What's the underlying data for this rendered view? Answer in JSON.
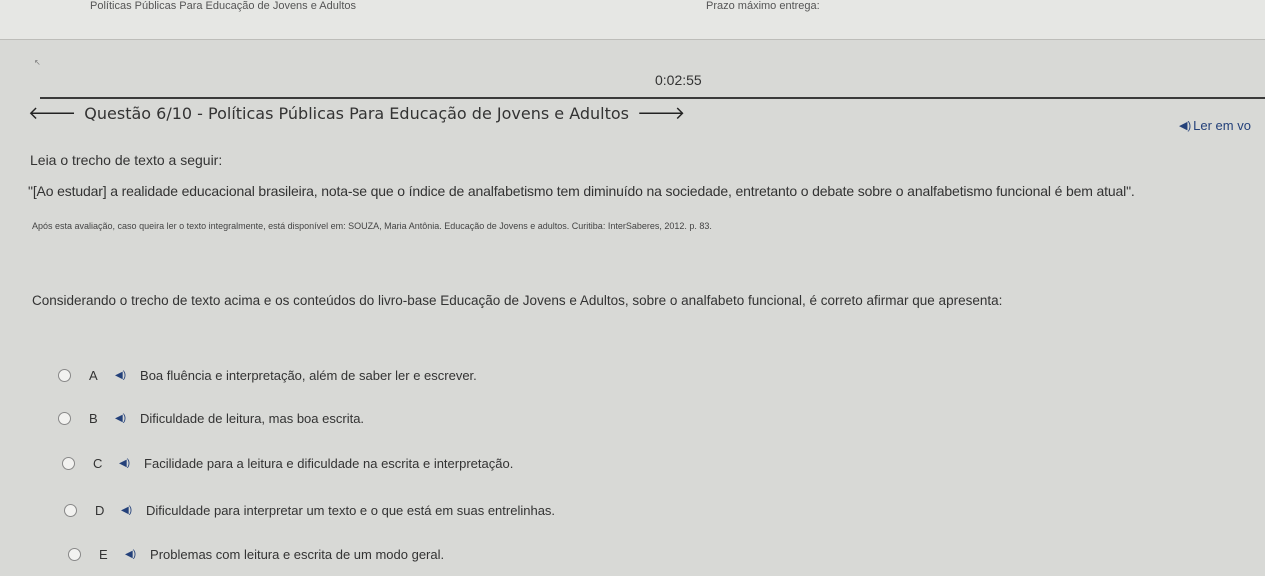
{
  "topbar": {
    "course_title": "Políticas Públicas Para Educação de Jovens e Adultos",
    "deadline_label": "Prazo máximo entrega:"
  },
  "timer": "0:02:55",
  "question": {
    "title": "Questão 6/10 - Políticas Públicas Para Educação de Jovens e Adultos",
    "listen_label": "Ler em vo",
    "intro": "Leia o trecho de texto a seguir:",
    "quote": "\"[Ao estudar] a realidade educacional brasileira, nota-se que o índice de analfabetismo tem diminuído na sociedade, entretanto o debate sobre o analfabetismo funcional é bem atual\".",
    "source": "Após esta avaliação, caso queira ler o texto integralmente, está disponível em: SOUZA, Maria Antônia. Educação de Jovens e adultos. Curitiba: InterSaberes, 2012. p. 83.",
    "prompt": "Considerando o trecho de texto acima e os conteúdos do livro-base Educação de Jovens e Adultos, sobre o analfabeto funcional, é correto afirmar que apresenta:"
  },
  "options": [
    {
      "letter": "A",
      "text": "Boa fluência e interpretação, além de saber ler e escrever."
    },
    {
      "letter": "B",
      "text": "Dificuldade de leitura, mas boa escrita."
    },
    {
      "letter": "C",
      "text": "Facilidade para a leitura e dificuldade na escrita e interpretação."
    },
    {
      "letter": "D",
      "text": "Dificuldade para interpretar um texto e o que está em suas entrelinhas."
    },
    {
      "letter": "E",
      "text": "Problemas com leitura e escrita de um modo geral."
    }
  ],
  "icons": {
    "back": "arrow-left-icon",
    "forward": "arrow-right-icon",
    "speaker": "speaker-icon"
  },
  "colors": {
    "accent": "#24417a",
    "background": "#d8d9d6"
  }
}
